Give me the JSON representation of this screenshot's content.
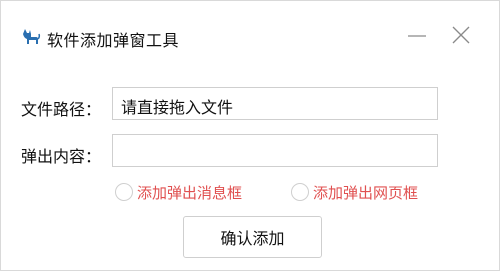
{
  "window": {
    "title": "软件添加弹窗工具",
    "icon": "cat-icon"
  },
  "form": {
    "path_label": "文件路径：",
    "path_value": "请直接拖入文件",
    "content_label": "弹出内容：",
    "content_value": "",
    "radio_message_label": "添加弹出消息框",
    "radio_webpage_label": "添加弹出网页框",
    "confirm_label": "确认添加"
  },
  "colors": {
    "radio_text": "#e05050"
  }
}
